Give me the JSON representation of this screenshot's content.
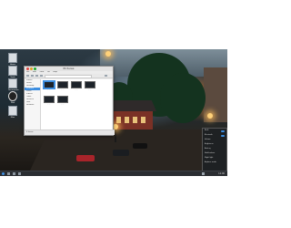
{
  "desktop_icons": [
    {
      "label": "Home"
    },
    {
      "label": "Trash"
    },
    {
      "label": "Documents"
    },
    {
      "label": "Disk"
    },
    {
      "label": "Files"
    }
  ],
  "window": {
    "title": "Pictures",
    "menu": [
      "File",
      "Edit",
      "View",
      "Go",
      "Help"
    ],
    "sidebar": [
      "Places",
      "Home",
      "Desktop",
      "Pictures",
      "Music",
      "Videos",
      "Trash",
      "Devices",
      "Disk",
      "Network"
    ],
    "sidebar_active_index": 3,
    "files": [
      {
        "name": "wallpaper1",
        "selected": true
      },
      {
        "name": "wallpaper2",
        "selected": false
      },
      {
        "name": "wallpaper3",
        "selected": false
      },
      {
        "name": "wallpaper4",
        "selected": false
      },
      {
        "name": "wallpaper5",
        "selected": false
      },
      {
        "name": "wallpaper6",
        "selected": false
      }
    ],
    "status": "6 items"
  },
  "tray_popup": {
    "rows": [
      "Wi-Fi",
      "Bluetooth",
      "Volume",
      "Brightness",
      "Battery",
      "Notifications",
      "Night light",
      "Airplane mode"
    ]
  },
  "taskbar": {
    "clock": "12:00"
  },
  "colors": {
    "accent": "#3d8ee0",
    "taskbar": "#2a2d31",
    "btn_close": "#e0443e",
    "btn_min": "#dea123",
    "btn_max": "#1aab29"
  }
}
